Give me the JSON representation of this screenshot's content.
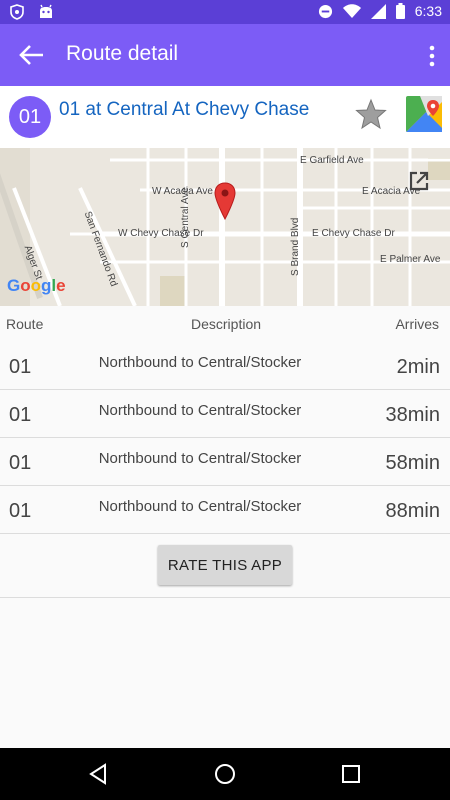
{
  "status_bar": {
    "time": "6:33",
    "icons": [
      "shield-icon",
      "android-icon",
      "do-not-disturb-icon",
      "wifi-icon",
      "signal-icon",
      "battery-icon"
    ]
  },
  "app_bar": {
    "title": "Route detail",
    "color": "#7c5cf6"
  },
  "stop": {
    "route_number": "01",
    "name": "01 at Central At Chevy Chase"
  },
  "map": {
    "labels": {
      "garfield": "E Garfield Ave",
      "w_acacia": "W Acacia Ave",
      "e_acacia": "E Acacia Ave",
      "w_chevy": "W Chevy Chase Dr",
      "e_chevy": "E Chevy Chase Dr",
      "e_palmer": "E Palmer Ave",
      "s_central": "S Central Ave",
      "s_brand": "S Brand Blvd",
      "san_fernando": "San Fernando Rd",
      "alger": "Alger St"
    },
    "logo": "Google"
  },
  "table": {
    "headers": {
      "route": "Route",
      "description": "Description",
      "arrives": "Arrives"
    },
    "rows": [
      {
        "route": "01",
        "description": "Northbound to Central/Stocker",
        "arrives": "2min"
      },
      {
        "route": "01",
        "description": "Northbound to Central/Stocker",
        "arrives": "38min"
      },
      {
        "route": "01",
        "description": "Northbound to Central/Stocker",
        "arrives": "58min"
      },
      {
        "route": "01",
        "description": "Northbound to Central/Stocker",
        "arrives": "88min"
      }
    ]
  },
  "rate_button": {
    "label": "RATE THIS APP"
  }
}
